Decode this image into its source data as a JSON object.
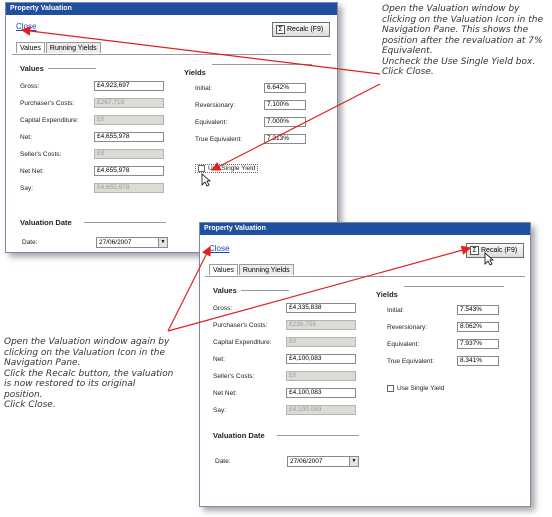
{
  "windows": [
    {
      "title": "Property Valuation",
      "close_label": "Close",
      "recalc_label": "Recalc (F9)",
      "tabs": [
        "Values",
        "Running Yields"
      ],
      "values_heading": "Values",
      "values": [
        {
          "label": "Gross:",
          "value": "£4,923,697",
          "disabled": false
        },
        {
          "label": "Purchaser's Costs:",
          "value": "£267,719",
          "disabled": true
        },
        {
          "label": "Capital Expenditure:",
          "value": "£0",
          "disabled": true
        },
        {
          "label": "Net:",
          "value": "£4,655,978",
          "disabled": false
        },
        {
          "label": "Seller's Costs:",
          "value": "£0",
          "disabled": true
        },
        {
          "label": "Net Net:",
          "value": "£4,655,978",
          "disabled": false
        },
        {
          "label": "Say:",
          "value": "£4,655,978",
          "disabled": true
        }
      ],
      "yields_heading": "Yields",
      "yields": [
        {
          "label": "Initial:",
          "value": "6.642%"
        },
        {
          "label": "Reversionary:",
          "value": "7.100%"
        },
        {
          "label": "Equivalent:",
          "value": "7.000%"
        },
        {
          "label": "True Equivalent:",
          "value": "7.313%"
        }
      ],
      "single_yield_label": "Use Single Yield",
      "valuation_date_heading": "Valuation Date",
      "date_label": "Date:",
      "date_value": "27/06/2007"
    },
    {
      "title": "Property Valuation",
      "close_label": "Close",
      "recalc_label": "Recalc (F9)",
      "tabs": [
        "Values",
        "Running Yields"
      ],
      "values_heading": "Values",
      "values": [
        {
          "label": "Gross:",
          "value": "£4,335,838",
          "disabled": false
        },
        {
          "label": "Purchaser's Costs:",
          "value": "£235,755",
          "disabled": true
        },
        {
          "label": "Capital Expenditure:",
          "value": "£0",
          "disabled": true
        },
        {
          "label": "Net:",
          "value": "£4,100,083",
          "disabled": false
        },
        {
          "label": "Seller's Costs:",
          "value": "£0",
          "disabled": true
        },
        {
          "label": "Net Net:",
          "value": "£4,100,083",
          "disabled": false
        },
        {
          "label": "Say:",
          "value": "£4,100,083",
          "disabled": true
        }
      ],
      "yields_heading": "Yields",
      "yields": [
        {
          "label": "Initial:",
          "value": "7.543%"
        },
        {
          "label": "Reversionary:",
          "value": "8.062%"
        },
        {
          "label": "Equivalent:",
          "value": "7.937%"
        },
        {
          "label": "True Equivalent:",
          "value": "8.341%"
        }
      ],
      "single_yield_label": "Use Single Yield",
      "valuation_date_heading": "Valuation Date",
      "date_label": "Date:",
      "date_value": "27/06/2007"
    }
  ],
  "notes": {
    "note1": [
      "Open the Valuation window by clicking on the Valuation Icon in the Navigation Pane. This shows the position after the revaluation at 7% Equivalent.",
      "Uncheck the Use Single Yield box. Click Close."
    ],
    "note2": [
      "Open the Valuation window again by clicking on the Valuation Icon in the Navigation Pane.",
      "Click the Recalc button, the valuation is now restored to its original position.",
      "Click Close."
    ]
  },
  "colors": {
    "title_bar": "#1e4fa0",
    "arrow": "#e02020",
    "link": "#1a3fbf",
    "disabled_field": "#dcdcd6"
  }
}
